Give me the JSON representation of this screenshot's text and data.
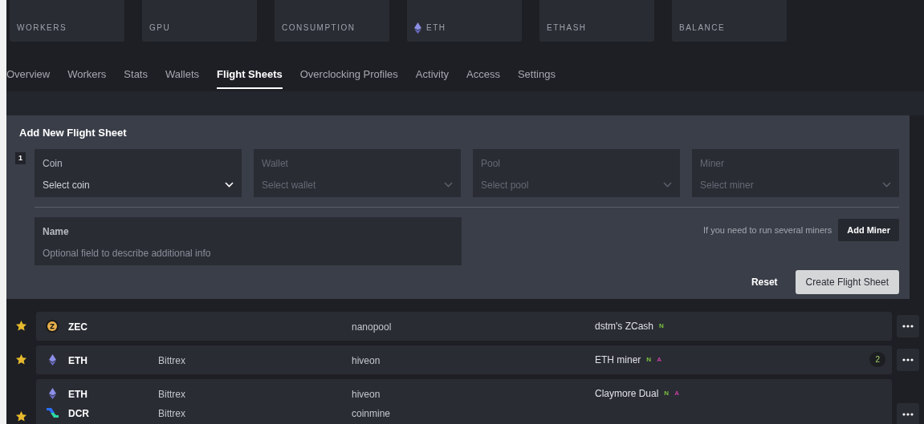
{
  "stats": [
    {
      "label": "WORKERS"
    },
    {
      "label": "GPU"
    },
    {
      "label": "CONSUMPTION"
    },
    {
      "label": "ETH",
      "kind": "eth"
    },
    {
      "label": "ETHASH"
    },
    {
      "label": "BALANCE"
    }
  ],
  "tabs": [
    {
      "label": "Overview",
      "selected": false
    },
    {
      "label": "Workers",
      "selected": false
    },
    {
      "label": "Stats",
      "selected": false
    },
    {
      "label": "Wallets",
      "selected": false
    },
    {
      "label": "Flight Sheets",
      "selected": true
    },
    {
      "label": "Overclocking Profiles",
      "selected": false
    },
    {
      "label": "Activity",
      "selected": false
    },
    {
      "label": "Access",
      "selected": false
    },
    {
      "label": "Settings",
      "selected": false
    }
  ],
  "form": {
    "title": "Add New Flight Sheet",
    "step": "1",
    "selects": [
      {
        "label": "Coin",
        "placeholder": "Select coin",
        "disabled": false
      },
      {
        "label": "Wallet",
        "placeholder": "Select wallet",
        "disabled": true
      },
      {
        "label": "Pool",
        "placeholder": "Select pool",
        "disabled": true
      },
      {
        "label": "Miner",
        "placeholder": "Select miner",
        "disabled": true
      }
    ],
    "name_field": {
      "label": "Name",
      "placeholder": "Optional field to describe additional info"
    },
    "hint": "If you need to run several miners",
    "add_button": "Add Miner",
    "reset_button": "Reset",
    "create_button": "Create Flight Sheet"
  },
  "flight_sheets": [
    {
      "favorite": true,
      "items": [
        {
          "kind": "zec",
          "coin": "ZEC",
          "pool": "nanopool",
          "miner": "dstm's ZCash",
          "tags": [
            {
              "text": "N",
              "kind": "nvidia"
            }
          ]
        }
      ]
    },
    {
      "favorite": true,
      "count": "2",
      "items": [
        {
          "kind": "eth",
          "coin": "ETH",
          "wallet": "Bittrex",
          "pool": "hiveon",
          "miner": "ETH miner",
          "tags": [
            {
              "text": "N",
              "kind": "nvidia"
            },
            {
              "text": "A",
              "kind": "amd"
            }
          ]
        }
      ]
    },
    {
      "favorite": true,
      "items": [
        {
          "kind": "eth",
          "coin": "ETH",
          "wallet": "Bittrex",
          "pool": "hiveon",
          "miner": "Claymore Dual",
          "tags": [
            {
              "text": "N",
              "kind": "nvidia"
            },
            {
              "text": "A",
              "kind": "amd"
            }
          ]
        },
        {
          "kind": "dcr",
          "coin": "DCR",
          "wallet": "Bittrex",
          "pool": "coinmine"
        }
      ]
    }
  ]
}
